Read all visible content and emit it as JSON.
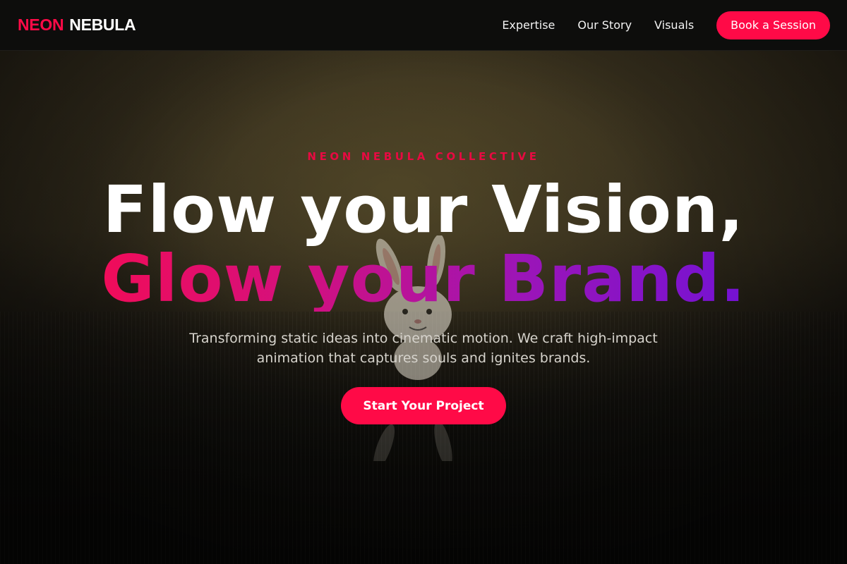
{
  "nav": {
    "logo_part1": "NEON",
    "logo_part2": "NEBULA",
    "links": [
      "Expertise",
      "Our Story",
      "Visuals"
    ],
    "cta": "Book a Session"
  },
  "hero": {
    "eyebrow": "NEON NEBULA COLLECTIVE",
    "headline_line1": "Flow your Vision,",
    "headline_line2": "Glow your Brand.",
    "subtitle": "Transforming static ideas into cinematic motion. We craft high-impact animation that captures souls and ignites brands.",
    "cta": "Start Your Project",
    "background_image": "dim scene with a small white bunny figure standing on a dark textured floor"
  },
  "colors": {
    "accent": "#ff0a47",
    "gradient_start": "#ff0a47",
    "gradient_end": "#6211e0",
    "nav_bg": "#0d0d0c"
  }
}
